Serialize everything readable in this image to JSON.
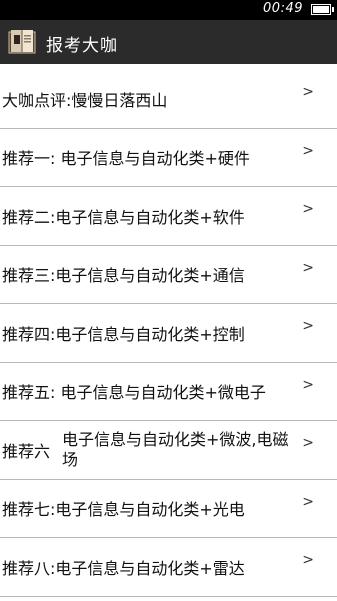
{
  "status_bar": {
    "time": "00:49",
    "battery_level": 1.0
  },
  "header": {
    "title": "报考大咖",
    "icon": "book-icon"
  },
  "list": {
    "chevron": ">",
    "items": [
      {
        "label": "大咖点评:慢慢日落西山"
      },
      {
        "label": "推荐一: 电子信息与自动化类+硬件"
      },
      {
        "label": "推荐二:电子信息与自动化类+软件"
      },
      {
        "label": "推荐三:电子信息与自动化类+通信"
      },
      {
        "label": "推荐四:电子信息与自动化类+控制"
      },
      {
        "label": "推荐五: 电子信息与自动化类+微电子"
      },
      {
        "lead": "推荐六",
        "trail": "电子信息与自动化类+微波,电磁场"
      },
      {
        "label": "推荐七:电子信息与自动化类+光电"
      },
      {
        "label": "推荐八:电子信息与自动化类+雷达"
      }
    ]
  }
}
